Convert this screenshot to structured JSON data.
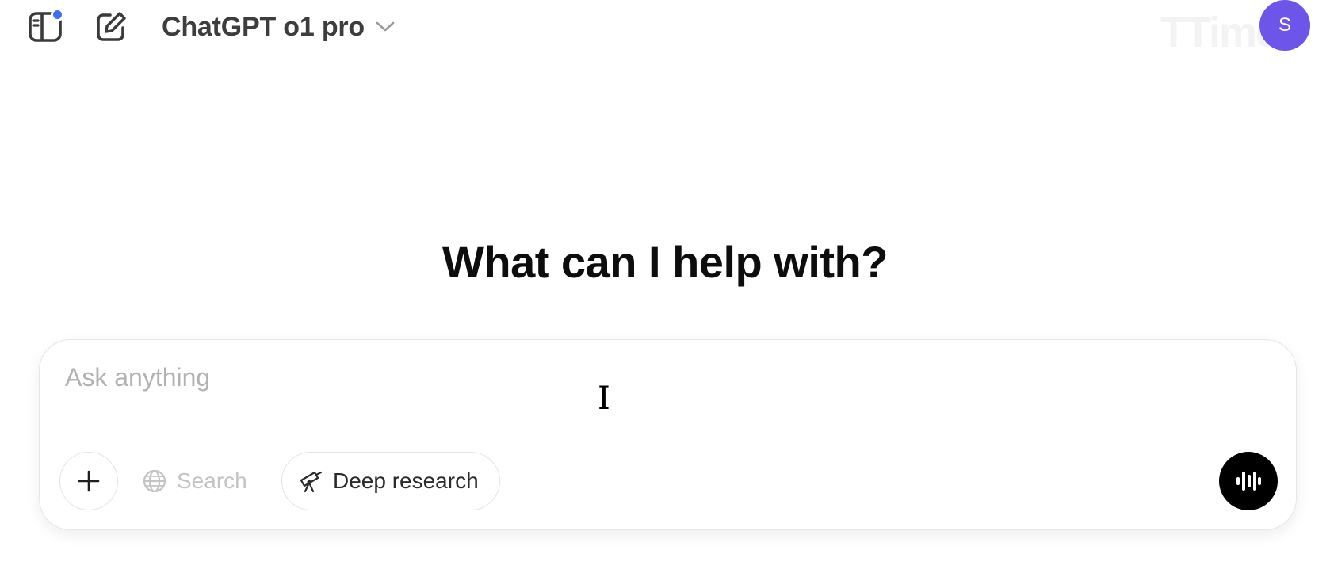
{
  "header": {
    "sidebar_icon": "sidebar-toggle-icon",
    "new_chat_icon": "new-chat-edit-icon",
    "model_name": "ChatGPT o1 pro",
    "model_chevron_icon": "chevron-down-icon",
    "avatar_initial": "S",
    "watermark": "TTimes",
    "colors": {
      "notification_dot": "#3d6df2",
      "avatar": "#6d55ea"
    }
  },
  "main": {
    "heading": "What can I help with?"
  },
  "composer": {
    "placeholder": "Ask anything",
    "value": "",
    "plus_icon": "plus-icon",
    "search_label": "Search",
    "search_icon": "globe-icon",
    "deep_research_label": "Deep research",
    "deep_research_icon": "telescope-icon",
    "voice_icon": "voice-waveform-icon",
    "cursor_glyph": "I"
  }
}
